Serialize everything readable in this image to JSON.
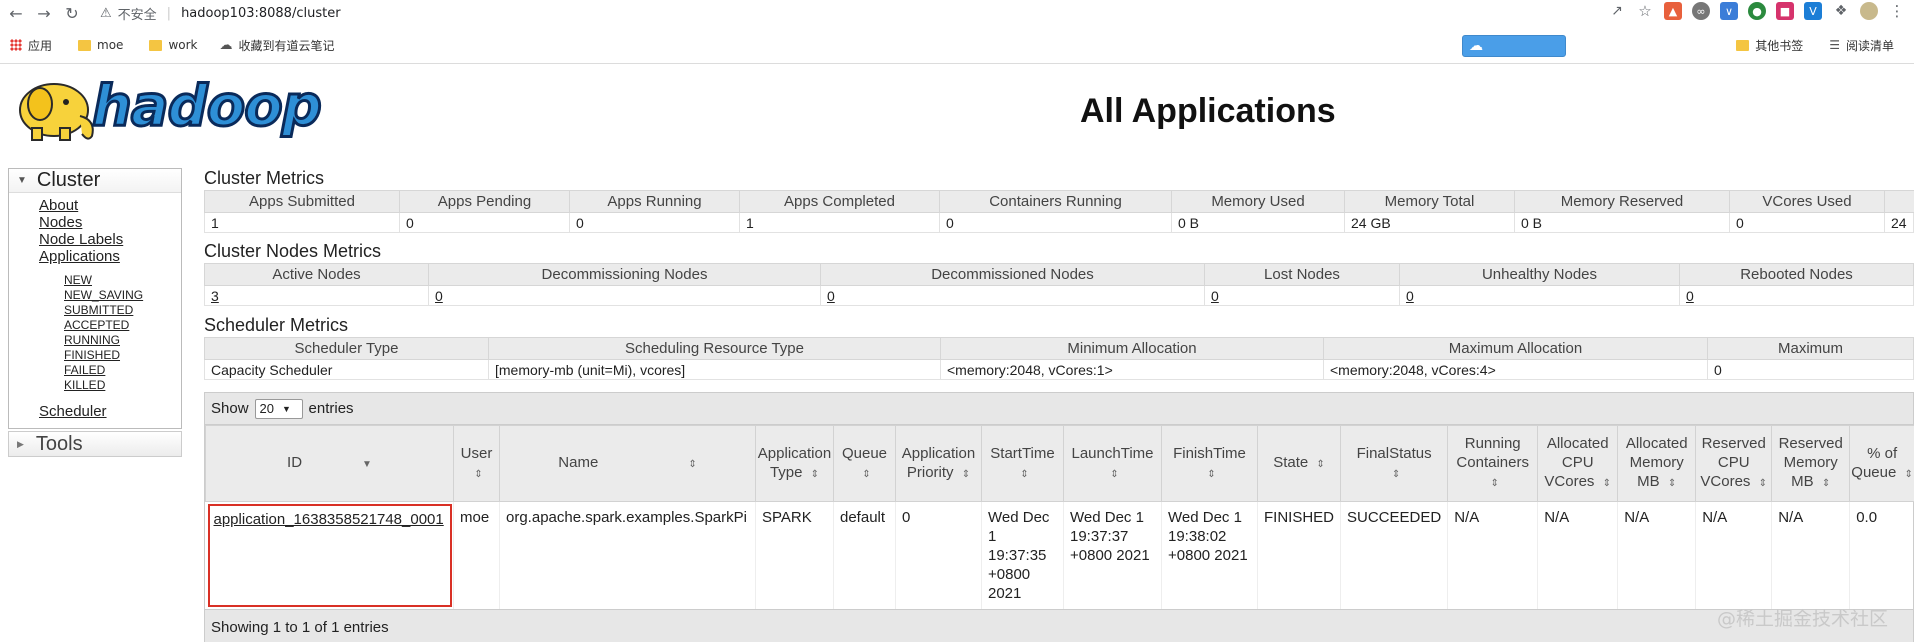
{
  "browser": {
    "insecure_label": "不安全",
    "url": "hadoop103:8088/cluster",
    "bookmarks": [
      "应用",
      "moe",
      "work",
      "收藏到有道云笔记"
    ],
    "bookmarks_right": [
      "其他书签",
      "阅读清单"
    ]
  },
  "header": {
    "logo_text": "hadoop",
    "title": "All Applications"
  },
  "sidebar": {
    "cluster_label": "Cluster",
    "links": [
      "About",
      "Nodes",
      "Node Labels",
      "Applications"
    ],
    "sub_links": [
      "NEW",
      "NEW_SAVING",
      "SUBMITTED",
      "ACCEPTED",
      "RUNNING",
      "FINISHED",
      "FAILED",
      "KILLED"
    ],
    "scheduler": "Scheduler",
    "tools_label": "Tools"
  },
  "cluster_metrics": {
    "title": "Cluster Metrics",
    "headers": [
      "Apps Submitted",
      "Apps Pending",
      "Apps Running",
      "Apps Completed",
      "Containers Running",
      "Memory Used",
      "Memory Total",
      "Memory Reserved",
      "VCores Used"
    ],
    "values": [
      "1",
      "0",
      "0",
      "1",
      "0",
      "0 B",
      "24 GB",
      "0 B",
      "0",
      "24"
    ]
  },
  "nodes_metrics": {
    "title": "Cluster Nodes Metrics",
    "headers": [
      "Active Nodes",
      "Decommissioning Nodes",
      "Decommissioned Nodes",
      "Lost Nodes",
      "Unhealthy Nodes",
      "Rebooted Nodes"
    ],
    "values": [
      "3",
      "0",
      "0",
      "0",
      "0",
      "0"
    ]
  },
  "scheduler_metrics": {
    "title": "Scheduler Metrics",
    "headers": [
      "Scheduler Type",
      "Scheduling Resource Type",
      "Minimum Allocation",
      "Maximum Allocation",
      "Maximum"
    ],
    "values": [
      "Capacity Scheduler",
      "[memory-mb (unit=Mi), vcores]",
      "<memory:2048, vCores:1>",
      "<memory:2048, vCores:4>",
      "0"
    ]
  },
  "apps_table": {
    "show_label": "Show",
    "page_size": "20",
    "entries_label": "entries",
    "headers": [
      "ID",
      "User",
      "Name",
      "Application Type",
      "Queue",
      "Application Priority",
      "StartTime",
      "LaunchTime",
      "FinishTime",
      "State",
      "FinalStatus",
      "Running Containers",
      "Allocated CPU VCores",
      "Allocated Memory MB",
      "Reserved CPU VCores",
      "Reserved Memory MB",
      "% of Queue"
    ],
    "rows": [
      [
        "application_1638358521748_0001",
        "moe",
        "org.apache.spark.examples.SparkPi",
        "SPARK",
        "default",
        "0",
        "Wed Dec 1 19:37:35 +0800 2021",
        "Wed Dec 1 19:37:37 +0800 2021",
        "Wed Dec 1 19:38:02 +0800 2021",
        "FINISHED",
        "SUCCEEDED",
        "N/A",
        "N/A",
        "N/A",
        "N/A",
        "N/A",
        "0.0"
      ]
    ],
    "footer": "Showing 1 to 1 of 1 entries"
  },
  "watermark": "@稀土掘金技术社区"
}
